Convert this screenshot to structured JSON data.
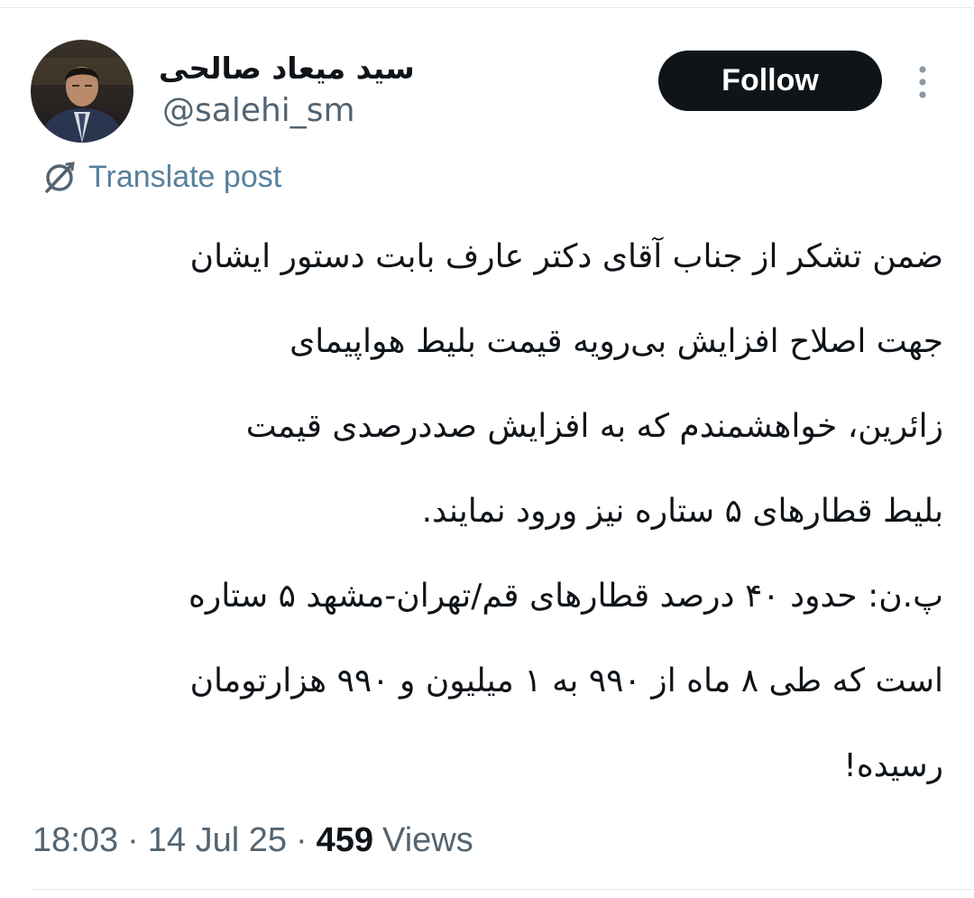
{
  "author": {
    "display_name": "سید میعاد صالحی",
    "handle": "@salehi_sm"
  },
  "follow_button": {
    "label": "Follow"
  },
  "translate": {
    "label": "Translate post"
  },
  "post": {
    "lines": [
      "ضمن تشکر از جناب آقای دکتر عارف بابت دستور ایشان",
      "جهت اصلاح افزایش بی‌رویه قیمت بلیط هواپیمای",
      "زائرین، خواهشمندم که به افزایش صددرصدی قیمت",
      "بلیط قطارهای ۵ ستاره نیز ورود نمایند.",
      "پ.ن: حدود ۴۰ درصد قطارهای قم/تهران-مشهد ۵ ستاره",
      "است که طی ۸ ماه از ۹۹۰ به ۱ میلیون و ۹۹۰ هزارتومان",
      "رسیده!"
    ]
  },
  "meta": {
    "time": "18:03",
    "date": "14 Jul 25",
    "separator": "·",
    "views_count": "459",
    "views_label": "Views"
  },
  "colors": {
    "text": "#0f1419",
    "secondary": "#536471",
    "link": "#3a86b8",
    "button_bg": "#0f1419",
    "button_text": "#ffffff"
  },
  "icons": {
    "avatar": "avatar-photo",
    "more": "more-vertical-icon",
    "translate": "translate-globe-icon"
  }
}
